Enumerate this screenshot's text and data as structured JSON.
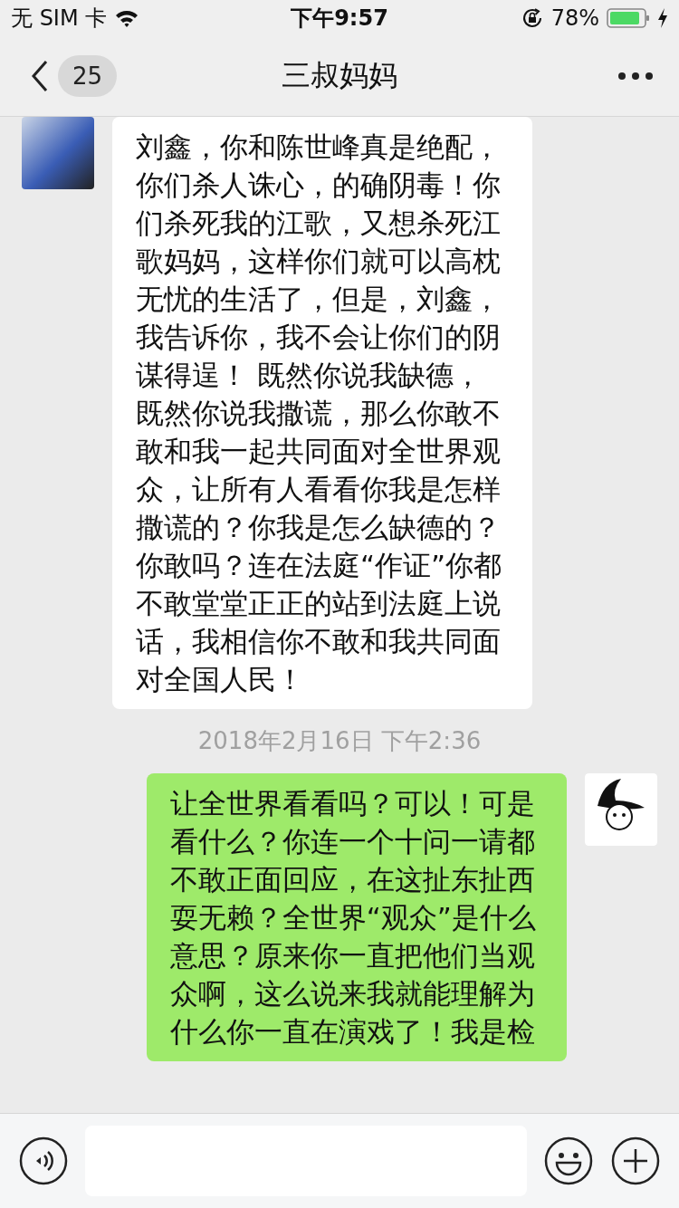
{
  "status_bar": {
    "carrier": "无 SIM 卡",
    "time": "下午9:57",
    "battery": "78%"
  },
  "nav": {
    "unread": "25",
    "title": "三叔妈妈"
  },
  "messages": [
    {
      "kind": "received",
      "text": "刘鑫，你和陈世峰真是绝配，你们杀人诛心，的确阴毒！你们杀死我的江歌，又想杀死江歌妈妈，这样你们就可以高枕无忧的生活了，但是，刘鑫，我告诉你，我不会让你们的阴谋得逞！ 既然你说我缺德，既然你说我撒谎，那么你敢不敢和我一起共同面对全世界观众，让所有人看看你我是怎样撒谎的？你我是怎么缺德的？你敢吗？连在法庭“作证”你都不敢堂堂正正的站到法庭上说话，我相信你不敢和我共同面对全国人民！"
    },
    {
      "kind": "time",
      "text": "2018年2月16日 下午2:36"
    },
    {
      "kind": "sent",
      "text": "让全世界看看吗？可以！可是看什么？你连一个十问一请都不敢正面回应，在这扯东扯西耍无赖？全世界“观众”是什么意思？原来你一直把他们当观众啊，这么说来我就能理解为什么你一直在演戏了！我是检"
    }
  ]
}
